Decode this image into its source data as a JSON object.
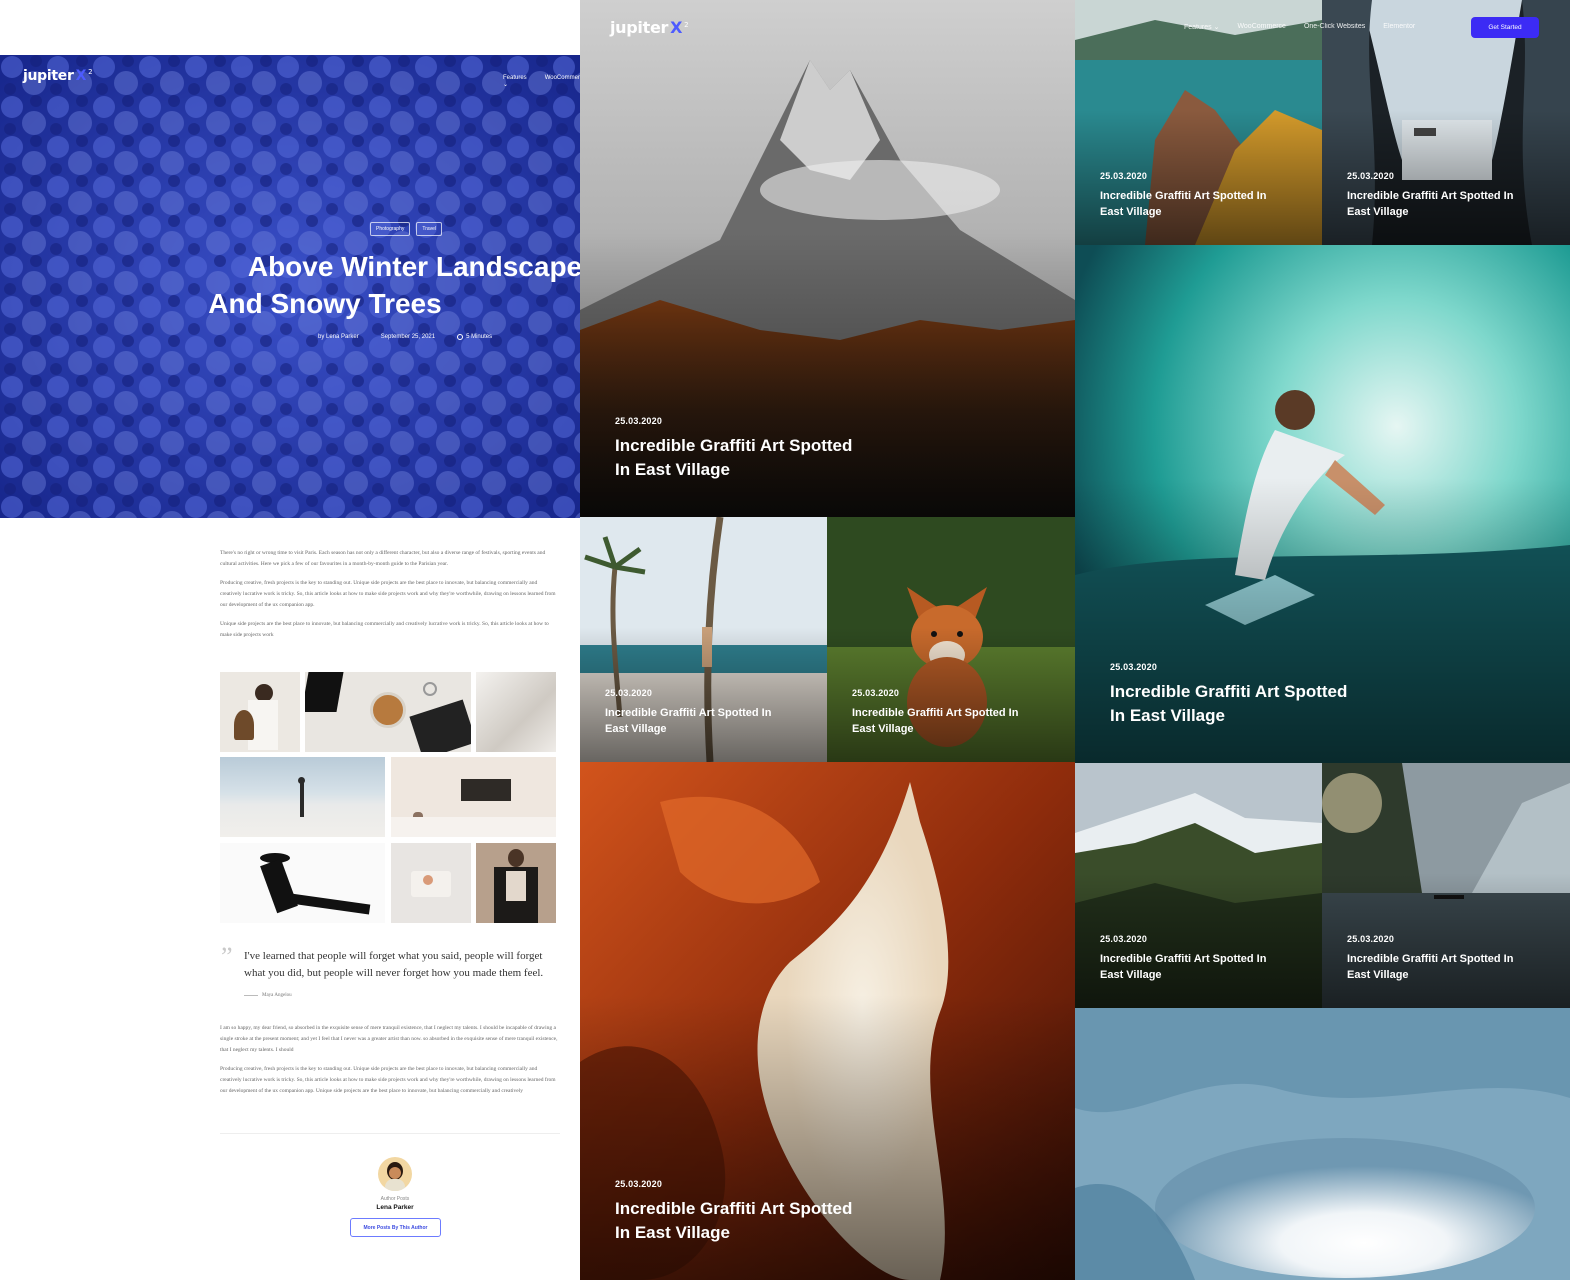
{
  "brand": {
    "name": "jupiter",
    "mark": "X",
    "version": "2"
  },
  "nav": {
    "items": [
      "Features ⌄",
      "WooCommerce",
      "One-Click Websites",
      "Elementor"
    ],
    "left_items": [
      "Features ⌄",
      "WooCommerce"
    ],
    "cta": "Get Started"
  },
  "post": {
    "tags": [
      "Photography",
      "Travel"
    ],
    "title_line1": "Above Winter Landscape",
    "title_line2": "And Snowy Trees",
    "author": "by Lena Parker",
    "date": "September 25, 2021",
    "read_time": "5 Minutes",
    "para1": "There's no right or wrong time to visit Paris. Each season has not only a different character, but also a diverse range of festivals, sporting events and cultural activities. Here we pick a few of our favourites in a month-by-month guide to the Parisian year.",
    "para2": "Producing creative, fresh projects is the key to standing out. Unique side projects are the best place to innovate, but balancing commercially and creatively lucrative work is tricky. So, this article looks at how to make side projects work and why they're worthwhile, drawing on lessons learned from our development of the ux companion app.",
    "para3": "Unique side projects are the best place to innovate, but balancing commercially and creatively lucrative work is tricky. So, this article looks at how to make side projects work",
    "quote": "I've learned that people will forget what you said, people will forget what you did, but people will never forget how you made them feel.",
    "quote_author": "Maya Angelou",
    "para4": "I am so happy, my dear friend, so absorbed in the exquisite sense of mere tranquil existence, that I neglect my talents. I should be incapable of drawing a single stroke at the present moment; and yet I feel that I never was a greater artist than now. so absorbed in the exquisite sense of mere tranquil existence, that I neglect my talents. I should",
    "para5": "Producing creative, fresh projects is the key to standing out. Unique side projects are the best place to innovate, but balancing commercially and creatively lucrative work is tricky. So, this article looks at how to make side projects work and why they're worthwhile, drawing on lessons learned from our development of the ux companion app. Unique side projects are the best place to innovate, but balancing commercially and creatively",
    "author_box_label": "Author Posts",
    "author_box_name": "Lena Parker",
    "author_button": "More Posts By This Author"
  },
  "cards": {
    "date": "25.03.2020",
    "title": "Incredible Graffiti Art Spotted In East Village"
  },
  "colors": {
    "accent": "#3c2bf5",
    "winter_blue": "#2b3fc0",
    "dark": "#1a1a1a"
  }
}
